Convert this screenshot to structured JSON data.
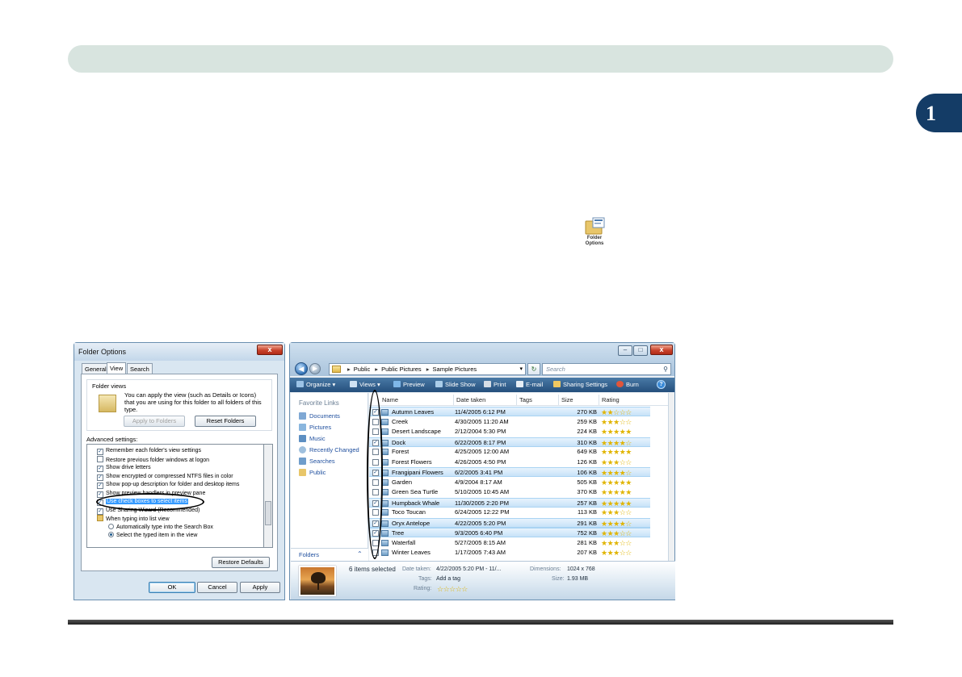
{
  "chapter_number": "1",
  "folder_options_icon": {
    "label_line1": "Folder",
    "label_line2": "Options"
  },
  "dialog": {
    "title": "Folder Options",
    "close_label": "x",
    "tabs": [
      "General",
      "View",
      "Search"
    ],
    "active_tab": "View",
    "folder_views_label": "Folder views",
    "folder_views_text": "You can apply the view (such as Details or Icons) that you are using for this folder to all folders of this type.",
    "apply_to_folders": "Apply to Folders",
    "reset_folders": "Reset Folders",
    "advanced_label": "Advanced settings:",
    "advanced_items": [
      {
        "type": "checkbox",
        "checked": true,
        "label": "Remember each folder's view settings"
      },
      {
        "type": "checkbox",
        "checked": false,
        "label": "Restore previous folder windows at logon"
      },
      {
        "type": "checkbox",
        "checked": true,
        "label": "Show drive letters"
      },
      {
        "type": "checkbox",
        "checked": true,
        "label": "Show encrypted or compressed NTFS files in color"
      },
      {
        "type": "checkbox",
        "checked": true,
        "label": "Show pop-up description for folder and desktop items"
      },
      {
        "type": "checkbox",
        "checked": true,
        "label": "Show preview handlers in preview pane"
      },
      {
        "type": "checkbox",
        "checked": true,
        "label": "Use check boxes to select items",
        "selected": true
      },
      {
        "type": "checkbox",
        "checked": true,
        "label": "Use Sharing Wizard (Recommended)"
      },
      {
        "type": "folder",
        "label": "When typing into list view"
      },
      {
        "type": "radio",
        "checked": false,
        "label": "Automatically type into the Search Box",
        "indent": true
      },
      {
        "type": "radio",
        "checked": true,
        "label": "Select the typed item in the view",
        "indent": true
      }
    ],
    "restore_defaults": "Restore Defaults",
    "ok": "OK",
    "cancel": "Cancel",
    "apply": "Apply"
  },
  "explorer": {
    "address": [
      "Public",
      "Public Pictures",
      "Sample Pictures"
    ],
    "search_placeholder": "Search",
    "toolbar": [
      "Organize",
      "Views",
      "Preview",
      "Slide Show",
      "Print",
      "E-mail",
      "Sharing Settings",
      "Burn"
    ],
    "favorite_links_title": "Favorite Links",
    "favorites": [
      "Documents",
      "Pictures",
      "Music",
      "Recently Changed",
      "Searches",
      "Public"
    ],
    "folders_label": "Folders",
    "columns": [
      "Name",
      "Date taken",
      "Tags",
      "Size",
      "Rating"
    ],
    "files": [
      {
        "name": "Autumn Leaves",
        "date": "11/4/2005 6:12 PM",
        "size": "270 KB",
        "checked": true,
        "rating": 2
      },
      {
        "name": "Creek",
        "date": "4/30/2005 11:20 AM",
        "size": "259 KB",
        "checked": false,
        "rating": 3
      },
      {
        "name": "Desert Landscape",
        "date": "2/12/2004 5:30 PM",
        "size": "224 KB",
        "checked": false,
        "rating": 5
      },
      {
        "name": "Dock",
        "date": "6/22/2005 8:17 PM",
        "size": "310 KB",
        "checked": true,
        "rating": 4
      },
      {
        "name": "Forest",
        "date": "4/25/2005 12:00 AM",
        "size": "649 KB",
        "checked": false,
        "rating": 5
      },
      {
        "name": "Forest Flowers",
        "date": "4/26/2005 4:50 PM",
        "size": "126 KB",
        "checked": false,
        "rating": 3
      },
      {
        "name": "Frangipani Flowers",
        "date": "6/2/2005 3:41 PM",
        "size": "106 KB",
        "checked": true,
        "rating": 4
      },
      {
        "name": "Garden",
        "date": "4/9/2004 8:17 AM",
        "size": "505 KB",
        "checked": false,
        "rating": 5
      },
      {
        "name": "Green Sea Turtle",
        "date": "5/10/2005 10:45 AM",
        "size": "370 KB",
        "checked": false,
        "rating": 5
      },
      {
        "name": "Humpback Whale",
        "date": "11/30/2005 2:20 PM",
        "size": "257 KB",
        "checked": true,
        "rating": 5
      },
      {
        "name": "Toco Toucan",
        "date": "6/24/2005 12:22 PM",
        "size": "113 KB",
        "checked": false,
        "rating": 3
      },
      {
        "name": "Oryx Antelope",
        "date": "4/22/2005 5:20 PM",
        "size": "291 KB",
        "checked": true,
        "rating": 4
      },
      {
        "name": "Tree",
        "date": "9/3/2005 6:40 PM",
        "size": "752 KB",
        "checked": true,
        "rating": 3
      },
      {
        "name": "Waterfall",
        "date": "5/27/2005 8:15 AM",
        "size": "281 KB",
        "checked": false,
        "rating": 3
      },
      {
        "name": "Winter Leaves",
        "date": "1/17/2005 7:43 AM",
        "size": "207 KB",
        "checked": false,
        "rating": 3
      }
    ],
    "details": {
      "count": "6 items selected",
      "date_taken_label": "Date taken:",
      "date_taken_value": "4/22/2005 5:20 PM - 11/...",
      "dimensions_label": "Dimensions:",
      "dimensions_value": "1024 x 768",
      "tags_label": "Tags:",
      "tags_value": "Add a tag",
      "size_label": "Size:",
      "size_value": "1.93 MB",
      "rating_label": "Rating:"
    }
  },
  "colors": {
    "header_bar": "#d8e4df",
    "chapter_tab": "#143c66",
    "selection": "#3399ff"
  }
}
